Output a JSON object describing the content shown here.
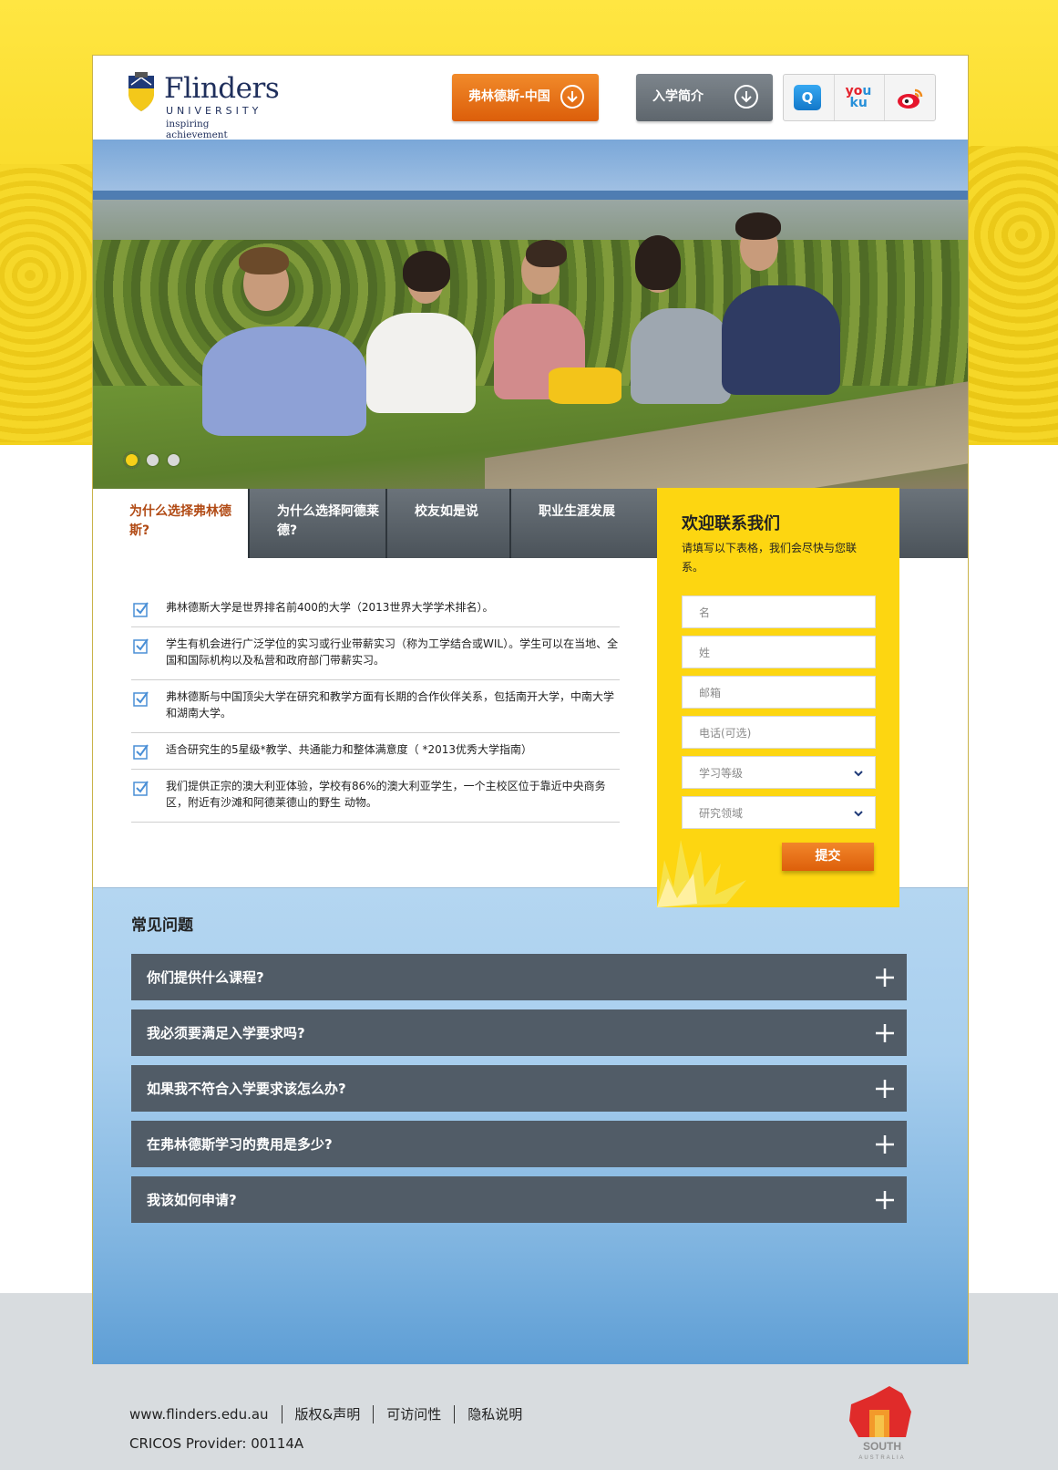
{
  "header": {
    "logo": {
      "name": "Flinders",
      "university": "UNIVERSITY",
      "tagline": "inspiring achievement"
    },
    "buttons": [
      {
        "label": "弗林德斯-中国"
      },
      {
        "label": "入学简介"
      }
    ],
    "social": [
      "qq-icon",
      "youku-icon",
      "weibo-icon"
    ]
  },
  "hero": {
    "slides": 3,
    "active_slide": 1
  },
  "tabs": [
    {
      "label": "为什么选择弗林德斯?"
    },
    {
      "label": "为什么选择阿德莱德?"
    },
    {
      "label": "校友如是说"
    },
    {
      "label": "职业生涯发展"
    }
  ],
  "bullets": [
    "弗林德斯大学是世界排名前400的大学（2013世界大学学术排名）。",
    "学生有机会进行广泛学位的实习或行业带薪实习（称为工学结合或WIL）。学生可以在当地、全国和国际机构以及私营和政府部门带薪实习。",
    "弗林德斯与中国顶尖大学在研究和教学方面有长期的合作伙伴关系，包括南开大学，中南大学和湖南大学。",
    "适合研究生的5星级*教学、共通能力和整体满意度（ *2013优秀大学指南）",
    "我们提供正宗的澳大利亚体验，学校有86%的澳大利亚学生，一个主校区位于靠近中央商务区，附近有沙滩和阿德莱德山的野生 动物。"
  ],
  "contact": {
    "title": "欢迎联系我们",
    "subtitle": "请填写以下表格，我们会尽快与您联系。",
    "fields": {
      "first_name": "名",
      "last_name": "姓",
      "email": "邮箱",
      "phone": "电话(可选)",
      "study_level": "学习等级",
      "study_area": "研究领域"
    },
    "submit": "提交"
  },
  "faq": {
    "title": "常见问题",
    "items": [
      "你们提供什么课程?",
      "我必须要满足入学要求吗?",
      "如果我不符合入学要求该怎么办?",
      "在弗林德斯学习的费用是多少?",
      "我该如何申请?"
    ]
  },
  "footer": {
    "links": [
      "www.flinders.edu.au",
      "版权&声明",
      "可访问性",
      "隐私说明"
    ],
    "cricos": "CRICOS Provider: 00114A",
    "sa_logo": {
      "word1": "SOUTH",
      "word2": "AUSTRALIA"
    }
  },
  "colors": {
    "accent_orange": "#e06a12",
    "brand_yellow": "#fdd611",
    "tab_gray": "#5b646b",
    "faq_bar": "#515c67"
  }
}
